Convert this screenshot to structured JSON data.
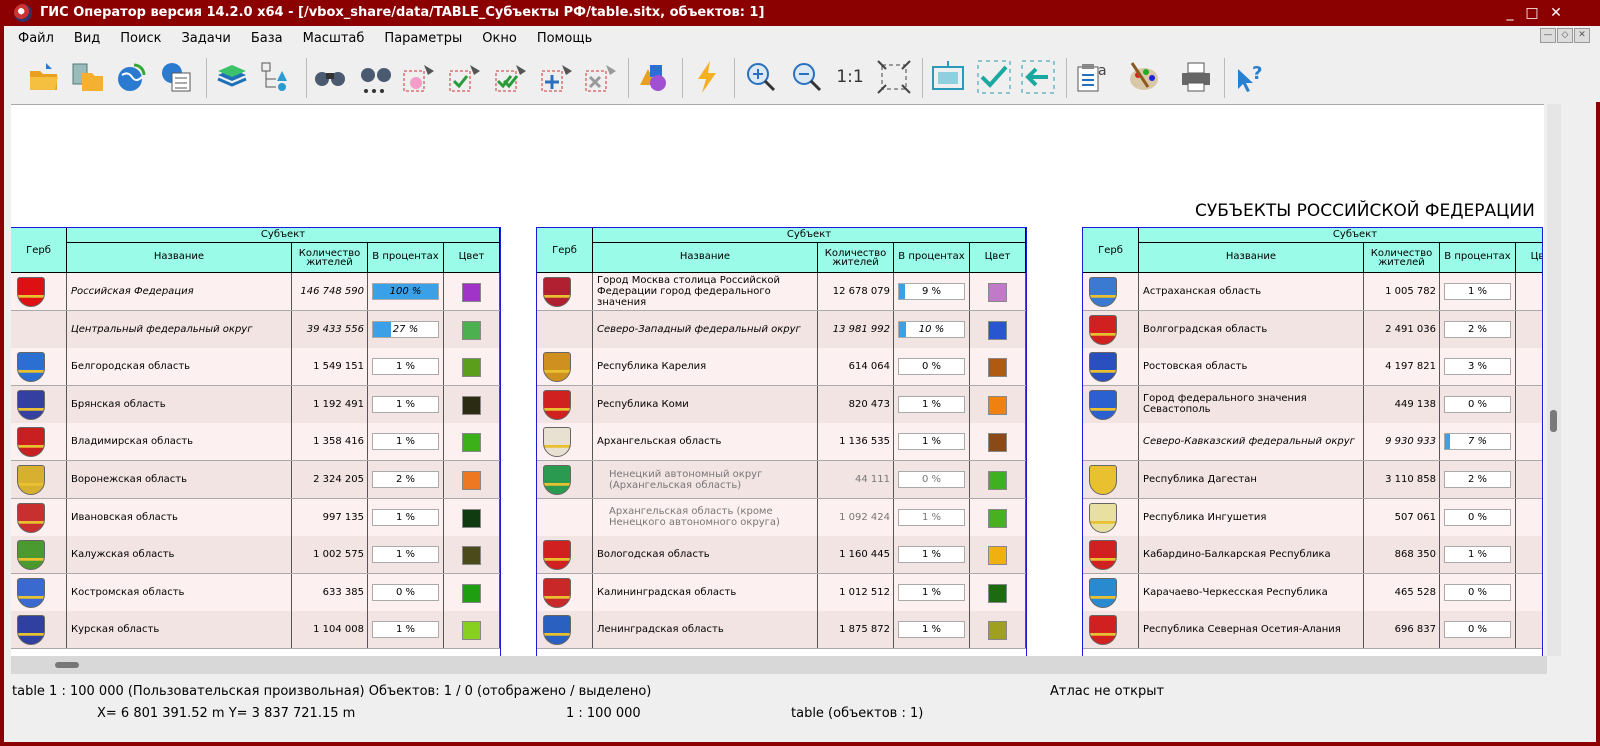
{
  "window": {
    "title": "ГИС Оператор версия 14.2.0 x64 - [/vbox_share/data/TABLE_Субъекты РФ/table.sitx, объектов: 1]"
  },
  "menu": [
    "Файл",
    "Вид",
    "Поиск",
    "Задачи",
    "База",
    "Масштаб",
    "Параметры",
    "Окно",
    "Помощь"
  ],
  "toolbar": {
    "zoom_1_1": "1:1"
  },
  "map": {
    "title": "СУБЪЕКТЫ РОССИЙСКОЙ ФЕДЕРАЦИИ",
    "headers": {
      "herb": "Герб",
      "subject": "Субъект",
      "name": "Название",
      "count1": "Количество",
      "count2": "жителей",
      "percent": "В процентах",
      "color": "Цвет"
    },
    "tables": [
      {
        "rows": [
          {
            "name": "Российская Федерация",
            "pop": "146 748 590",
            "pct": "100 %",
            "pv": 100,
            "color": "#a033c8",
            "coat": "#d11",
            "style": "it"
          },
          {
            "name": "Центральный федеральный округ",
            "pop": "39 433 556",
            "pct": "27 %",
            "pv": 27,
            "color": "#4caf50",
            "coat": "",
            "style": "it"
          },
          {
            "name": "Белгородская область",
            "pop": "1 549 151",
            "pct": "1 %",
            "pv": 1,
            "color": "#5a9e1c",
            "coat": "#2a6fd1",
            "style": ""
          },
          {
            "name": "Брянская область",
            "pop": "1 192 491",
            "pct": "1 %",
            "pv": 1,
            "color": "#2b2b14",
            "coat": "#3340a0",
            "style": ""
          },
          {
            "name": "Владимирская область",
            "pop": "1 358 416",
            "pct": "1 %",
            "pv": 1,
            "color": "#3cb018",
            "coat": "#c82020",
            "style": ""
          },
          {
            "name": "Воронежская область",
            "pop": "2 324 205",
            "pct": "2 %",
            "pv": 2,
            "color": "#ee7722",
            "coat": "#d8b030",
            "style": ""
          },
          {
            "name": "Ивановская область",
            "pop": "997 135",
            "pct": "1 %",
            "pv": 1,
            "color": "#103a10",
            "coat": "#c83030",
            "style": ""
          },
          {
            "name": "Калужская область",
            "pop": "1 002 575",
            "pct": "1 %",
            "pv": 1,
            "color": "#4a4a1a",
            "coat": "#4a9a30",
            "style": ""
          },
          {
            "name": "Костромская область",
            "pop": "633 385",
            "pct": "0 %",
            "pv": 0,
            "color": "#1e9e10",
            "coat": "#3a6ad0",
            "style": ""
          },
          {
            "name": "Курская область",
            "pop": "1 104 008",
            "pct": "1 %",
            "pv": 1,
            "color": "#88d020",
            "coat": "#3040a0",
            "style": ""
          }
        ]
      },
      {
        "rows": [
          {
            "name": "Город Москва столица Российской Федерации город федерального значения",
            "pop": "12 678 079",
            "pct": "9 %",
            "pv": 9,
            "color": "#c07ac8",
            "coat": "#b02030",
            "style": ""
          },
          {
            "name": "Северо-Западный федеральный округ",
            "pop": "13 981 992",
            "pct": "10 %",
            "pv": 10,
            "color": "#2a55d0",
            "coat": "",
            "style": "it"
          },
          {
            "name": "Республика Карелия",
            "pop": "614 064",
            "pct": "0 %",
            "pv": 0,
            "color": "#b05a10",
            "coat": "#d09020",
            "style": ""
          },
          {
            "name": "Республика Коми",
            "pop": "820 473",
            "pct": "1 %",
            "pv": 1,
            "color": "#f08010",
            "coat": "#d02020",
            "style": ""
          },
          {
            "name": "Архангельская область",
            "pop": "1 136 535",
            "pct": "1 %",
            "pv": 1,
            "color": "#8a4a18",
            "coat": "#e8e0d0",
            "style": ""
          },
          {
            "name": "Ненецкий автономный округ (Архангельская область)",
            "pop": "44 111",
            "pct": "0 %",
            "pv": 0,
            "color": "#40b020",
            "coat": "#2a9a50",
            "style": "gr"
          },
          {
            "name": "Архангельская область (кроме Ненецкого автономного округа)",
            "pop": "1 092 424",
            "pct": "1 %",
            "pv": 1,
            "color": "#4ab020",
            "coat": "",
            "style": "gr"
          },
          {
            "name": "Вологодская область",
            "pop": "1 160 445",
            "pct": "1 %",
            "pv": 1,
            "color": "#f0b010",
            "coat": "#d02020",
            "style": ""
          },
          {
            "name": "Калининградская область",
            "pop": "1 012 512",
            "pct": "1 %",
            "pv": 1,
            "color": "#1e6a10",
            "coat": "#c82828",
            "style": ""
          },
          {
            "name": "Ленинградская область",
            "pop": "1 875 872",
            "pct": "1 %",
            "pv": 1,
            "color": "#a0a020",
            "coat": "#2a60c0",
            "style": ""
          }
        ]
      },
      {
        "rows": [
          {
            "name": "Астраханская область",
            "pop": "1 005 782",
            "pct": "1 %",
            "pv": 1,
            "color": "",
            "coat": "#3a7ad0",
            "style": ""
          },
          {
            "name": "Волгоградская область",
            "pop": "2 491 036",
            "pct": "2 %",
            "pv": 2,
            "color": "",
            "coat": "#d02020",
            "style": ""
          },
          {
            "name": "Ростовская область",
            "pop": "4 197 821",
            "pct": "3 %",
            "pv": 3,
            "color": "",
            "coat": "#2a50c0",
            "style": ""
          },
          {
            "name": "Город федерального значения Севастополь",
            "pop": "449 138",
            "pct": "0 %",
            "pv": 0,
            "color": "",
            "coat": "#2a60d0",
            "style": ""
          },
          {
            "name": "Северо-Кавказский федеральный округ",
            "pop": "9 930 933",
            "pct": "7 %",
            "pv": 7,
            "color": "",
            "coat": "",
            "style": "it"
          },
          {
            "name": "Республика Дагестан",
            "pop": "3 110 858",
            "pct": "2 %",
            "pv": 2,
            "color": "",
            "coat": "#e8c030",
            "style": ""
          },
          {
            "name": "Республика Ингушетия",
            "pop": "507 061",
            "pct": "0 %",
            "pv": 0,
            "color": "",
            "coat": "#e8e0a0",
            "style": ""
          },
          {
            "name": "Кабардино-Балкарская Республика",
            "pop": "868 350",
            "pct": "1 %",
            "pv": 1,
            "color": "",
            "coat": "#d02020",
            "style": ""
          },
          {
            "name": "Карачаево-Черкесская Республика",
            "pop": "465 528",
            "pct": "0 %",
            "pv": 0,
            "color": "",
            "coat": "#2a8ad0",
            "style": ""
          },
          {
            "name": "Республика Северная Осетия-Алания",
            "pop": "696 837",
            "pct": "0 %",
            "pv": 0,
            "color": "",
            "coat": "#d02020",
            "style": ""
          }
        ]
      }
    ]
  },
  "status": {
    "line1": "table  1 : 100 000 (Пользовательская произвольная) Объектов: 1 / 0 (отображено / выделено)",
    "atlas": "Атлас не открыт",
    "coords": "X= 6 801 391.52 m     Y= 3 837 721.15 m",
    "scale": "1 : 100 000",
    "layer": "table   (объектов : 1)"
  }
}
